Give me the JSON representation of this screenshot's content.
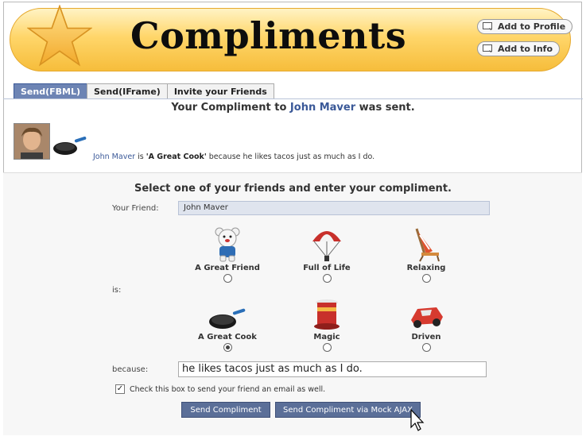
{
  "app": {
    "title": "Compliments",
    "add_to_profile": "Add to Profile",
    "add_to_info": "Add to Info"
  },
  "tabs": [
    {
      "label": "Send(FBML)",
      "active": true
    },
    {
      "label": "Send(IFrame)",
      "active": false
    },
    {
      "label": "Invite your Friends",
      "active": false
    }
  ],
  "confirmation": {
    "prefix": "Your Compliment to ",
    "friend_name": "John Maver",
    "suffix": " was sent."
  },
  "story": {
    "friend_name": "John Maver",
    "mid": " is ",
    "compliment": "'A Great Cook'",
    "rest": " because he likes tacos just as much as I do."
  },
  "form": {
    "heading": "Select one of your friends and enter your compliment.",
    "friend_label": "Your Friend:",
    "friend_value": "John Maver",
    "is_label": "is:",
    "options": [
      {
        "label": "A Great Friend",
        "icon": "teddy-bear-icon",
        "checked": false
      },
      {
        "label": "Full of Life",
        "icon": "parachute-icon",
        "checked": false
      },
      {
        "label": "Relaxing",
        "icon": "beach-chair-icon",
        "checked": false
      },
      {
        "label": "A Great Cook",
        "icon": "frying-pan-icon",
        "checked": true
      },
      {
        "label": "Magic",
        "icon": "magic-hat-icon",
        "checked": false
      },
      {
        "label": "Driven",
        "icon": "race-car-icon",
        "checked": false
      }
    ],
    "because_label": "because:",
    "because_value": "he likes tacos just as much as I do.",
    "email_checkbox_label": "Check this box to send your friend an email as well.",
    "email_checked": true,
    "send_button": "Send Compliment",
    "send_ajax_button": "Send Compliment via Mock AJAX"
  },
  "colors": {
    "banner": "#f6bd3b",
    "link": "#3b5998",
    "button": "#5b6f98",
    "active_tab": "#6d84b4"
  }
}
